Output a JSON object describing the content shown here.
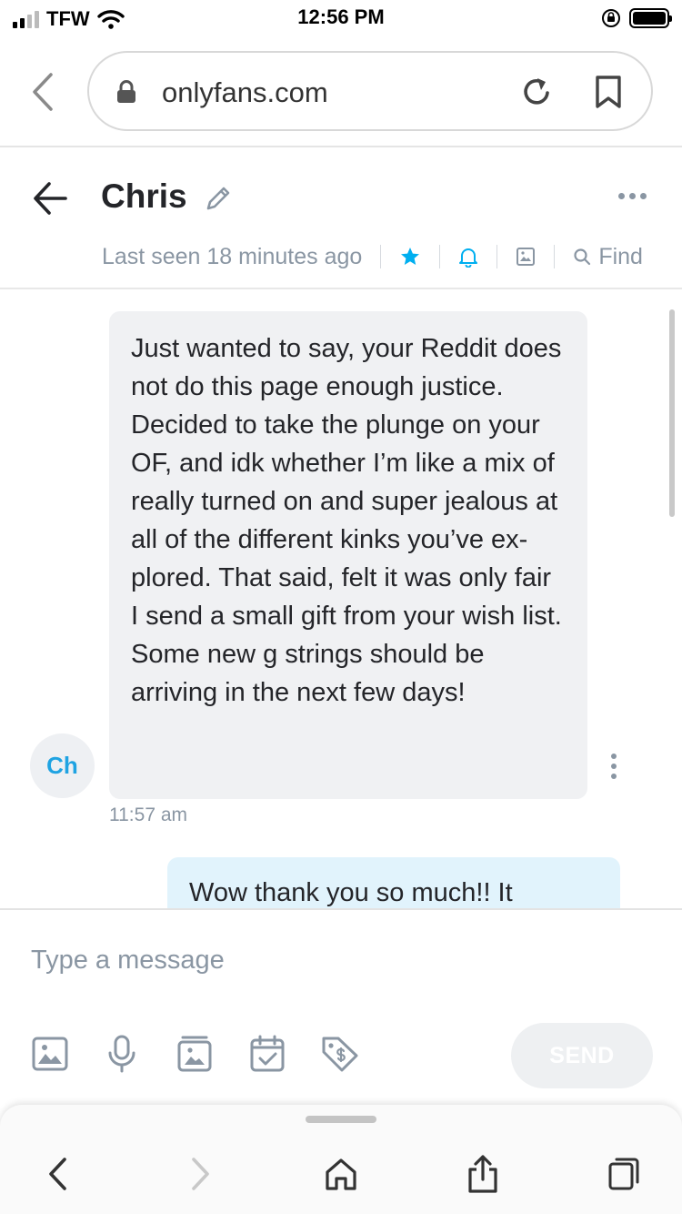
{
  "status_bar": {
    "carrier": "TFW",
    "time": "12:56 PM",
    "signal_bars_active": 2,
    "signal_bars_total": 4
  },
  "browser": {
    "url": "onlyfans.com",
    "icons": [
      "back-chevron-icon",
      "lock-icon",
      "reload-icon",
      "bookmark-icon"
    ]
  },
  "chat": {
    "name": "Chris",
    "last_seen": "Last seen 18 minutes ago",
    "find_label": "Find",
    "header_icons": [
      "back-arrow-icon",
      "pencil-icon",
      "more-icon",
      "star-icon",
      "bell-icon",
      "gallery-icon",
      "search-icon"
    ],
    "accent_color": "#00aff0"
  },
  "messages": [
    {
      "direction": "incoming",
      "avatar_initials": "Ch",
      "text": "Just wanted to say, your Reddit does not do this page enough justice. Decided to take the plunge on your OF, and idk whether I’m like a mix of really turned on and super jealous at all of the different kinks you’ve ex-plored. That said, felt it was only fair I send a small gift from your wish list. Some new g strings should be arriving in the next few days!",
      "time": "11:57 am"
    },
    {
      "direction": "outgoing",
      "text": "Wow thank you so much!! It"
    }
  ],
  "composer": {
    "placeholder": "Type a message",
    "send_label": "SEND",
    "tools": [
      "image-icon",
      "microphone-icon",
      "vault-icon",
      "calendar-icon",
      "price-tag-icon"
    ]
  },
  "bottom_toolbar": {
    "icons": [
      "back-icon",
      "forward-icon",
      "home-icon",
      "share-icon",
      "tabs-icon"
    ]
  }
}
